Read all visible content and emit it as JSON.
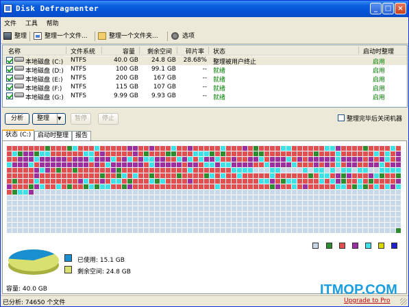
{
  "window": {
    "title": "Disk Defragmenter",
    "watermark": "ITMOP.COM"
  },
  "menu": [
    "文件",
    "工具",
    "帮助"
  ],
  "toolbar": {
    "defrag": "整理",
    "defrag_file": "整理一个文件...",
    "defrag_folder": "整理一个文件夹...",
    "options": "选项"
  },
  "columns": {
    "name": "名称",
    "fs": "文件系统",
    "capacity": "容量",
    "free": "剩余空间",
    "frag": "碎片率",
    "status": "状态",
    "boot": "启动时整理"
  },
  "drives": [
    {
      "name": "本地磁盘 (C:)",
      "fs": "NTFS",
      "capacity": "40.0 GB",
      "free": "24.8 GB",
      "frag": "28.68%",
      "status": "整理被用户终止",
      "boot": "启用"
    },
    {
      "name": "本地磁盘 (D:)",
      "fs": "NTFS",
      "capacity": "100 GB",
      "free": "99.1 GB",
      "frag": "--",
      "status": "就绪",
      "boot": "启用"
    },
    {
      "name": "本地磁盘 (E:)",
      "fs": "NTFS",
      "capacity": "200 GB",
      "free": "167 GB",
      "frag": "--",
      "status": "就绪",
      "boot": "启用"
    },
    {
      "name": "本地磁盘 (F:)",
      "fs": "NTFS",
      "capacity": "115 GB",
      "free": "107 GB",
      "frag": "--",
      "status": "就绪",
      "boot": "启用"
    },
    {
      "name": "本地磁盘 (G:)",
      "fs": "NTFS",
      "capacity": "9.99 GB",
      "free": "9.93 GB",
      "frag": "--",
      "status": "就绪",
      "boot": "启用"
    }
  ],
  "controls": {
    "analyze": "分析",
    "defrag": "整理",
    "pause": "暂停",
    "stop": "停止",
    "shutdown": "整理完毕后关闭机器"
  },
  "tabs": [
    "状态 (C:)",
    "启动时整理",
    "报告"
  ],
  "legend_colors": [
    "#c8d8e8",
    "#2e8b2e",
    "#e05050",
    "#9b2fa0",
    "#40e0e8",
    "#d8d800",
    "#1e20c8"
  ],
  "usage": {
    "used_label": "已使用: 15.1 GB",
    "free_label": "剩余空间: 24.8 GB",
    "used_color": "#1a8fd0",
    "free_color": "#d8e070",
    "used_fraction": 0.378
  },
  "capacity": "容量: 40.0 GB",
  "statusbar": {
    "analyzed": "已分析: 74650 个文件",
    "upgrade": "Upgrade to Pro"
  },
  "colors": {
    "fragmented": "#e05050",
    "contiguous": "#2e8b2e",
    "system": "#9b2fa0",
    "mft": "#40e0e8",
    "free": "#c8d8e8"
  }
}
